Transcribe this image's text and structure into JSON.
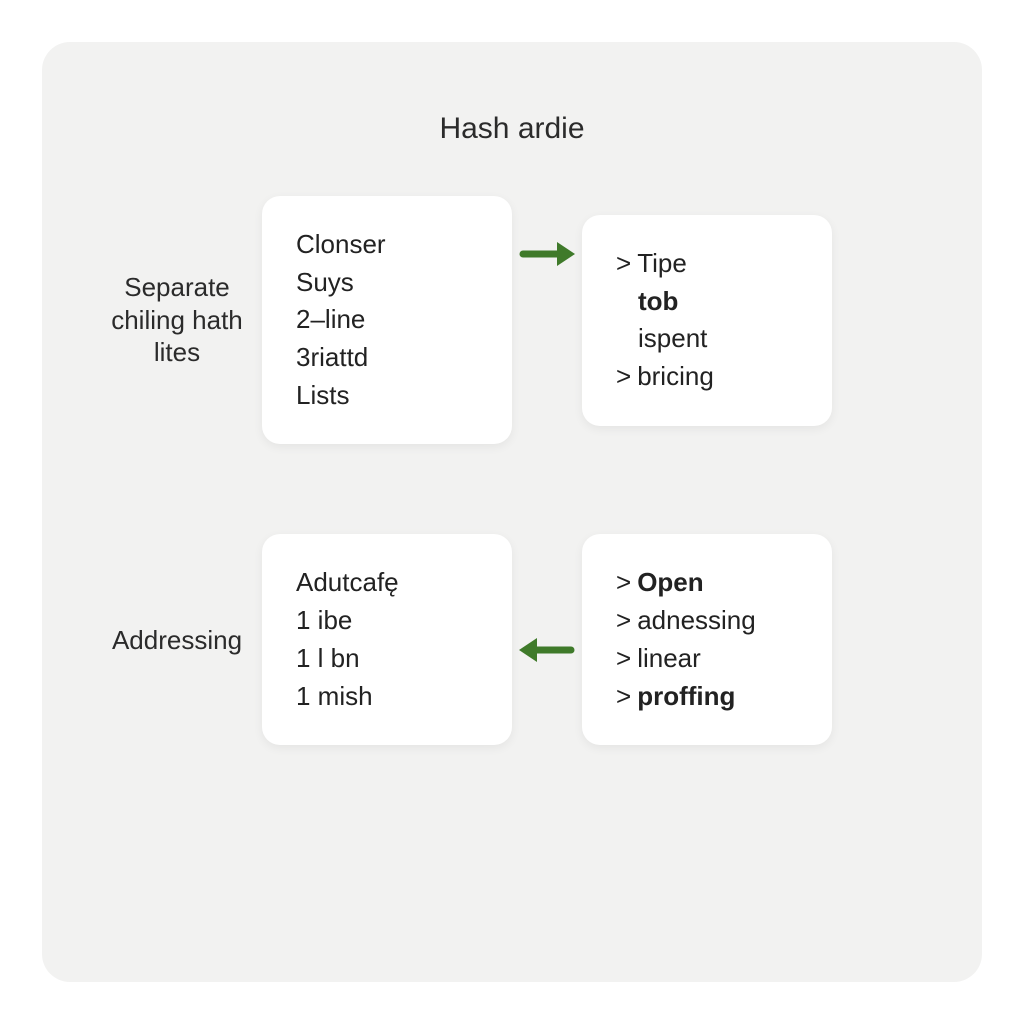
{
  "title": "Hash ardie",
  "arrow_color": "#3f7a2a",
  "rows": [
    {
      "label": "Separate chiling hath lites",
      "direction": "right",
      "left_card": {
        "lines": [
          {
            "text": "Clonser",
            "bold": false,
            "chevron": false
          },
          {
            "text": "Suys",
            "bold": false,
            "chevron": false
          },
          {
            "text": "2–line",
            "bold": false,
            "chevron": false
          },
          {
            "text": "3riattd",
            "bold": false,
            "chevron": false
          },
          {
            "text": "Lists",
            "bold": false,
            "chevron": false
          }
        ]
      },
      "right_card": {
        "lines": [
          {
            "text": "Tipe",
            "bold": false,
            "chevron": true
          },
          {
            "text": "tob",
            "bold": true,
            "chevron": false,
            "indent": true
          },
          {
            "text": "ispent",
            "bold": false,
            "chevron": false,
            "indent": true
          },
          {
            "text": "bricing",
            "bold": false,
            "chevron": true
          }
        ]
      }
    },
    {
      "label": "Addressing",
      "direction": "left",
      "left_card": {
        "lines": [
          {
            "text": "Adutcafę",
            "bold": false,
            "chevron": false
          },
          {
            "text": "1 ibe",
            "bold": false,
            "chevron": false
          },
          {
            "text": "1 l bn",
            "bold": false,
            "chevron": false
          },
          {
            "text": "1 mish",
            "bold": false,
            "chevron": false
          }
        ]
      },
      "right_card": {
        "lines": [
          {
            "text": "Open",
            "bold": true,
            "chevron": true
          },
          {
            "text": "adnessing",
            "bold": false,
            "chevron": true
          },
          {
            "text": "linear",
            "bold": false,
            "chevron": true
          },
          {
            "text": "proffing",
            "bold": true,
            "chevron": true
          }
        ]
      }
    }
  ]
}
